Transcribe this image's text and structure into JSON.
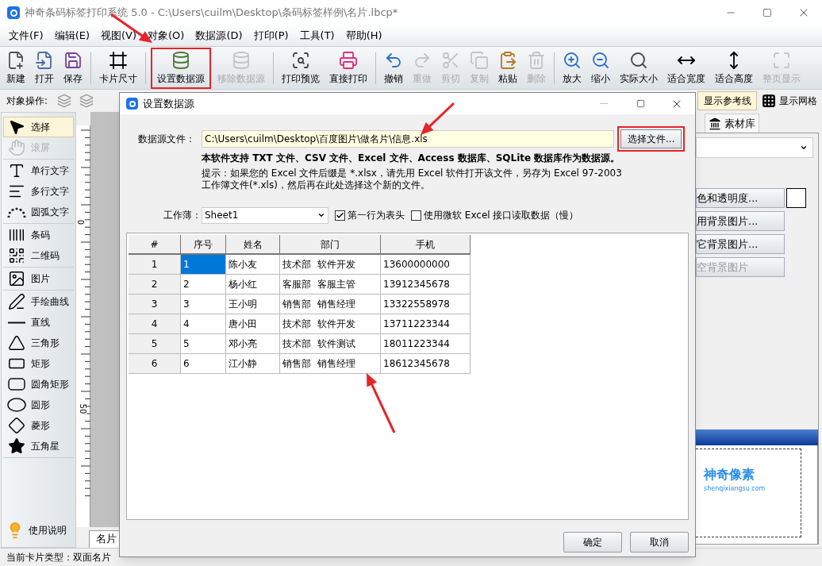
{
  "window": {
    "title": "神奇条码标签打印系统 5.0 - C:\\Users\\cuilm\\Desktop\\条码标签样例\\名片.lbcp*"
  },
  "menu": [
    "文件(F)",
    "编辑(E)",
    "视图(V)",
    "对象(O)",
    "数据源(D)",
    "打印(P)",
    "工具(T)",
    "帮助(H)"
  ],
  "toolbar": [
    {
      "label": "新建",
      "disabled": false
    },
    {
      "label": "打开",
      "disabled": false
    },
    {
      "label": "保存",
      "disabled": false
    },
    {
      "label": "卡片尺寸",
      "disabled": false
    },
    {
      "label": "设置数据源",
      "disabled": false
    },
    {
      "label": "移除数据源",
      "disabled": true
    },
    {
      "label": "打印预览",
      "disabled": false
    },
    {
      "label": "直接打印",
      "disabled": false
    },
    {
      "label": "撤销",
      "disabled": false
    },
    {
      "label": "重做",
      "disabled": true
    },
    {
      "label": "剪切",
      "disabled": true
    },
    {
      "label": "复制",
      "disabled": true
    },
    {
      "label": "粘贴",
      "disabled": false
    },
    {
      "label": "删除",
      "disabled": true
    },
    {
      "label": "放大",
      "disabled": false
    },
    {
      "label": "缩小",
      "disabled": false
    },
    {
      "label": "实际大小",
      "disabled": false
    },
    {
      "label": "适合宽度",
      "disabled": false
    },
    {
      "label": "适合高度",
      "disabled": false
    },
    {
      "label": "整页显示",
      "disabled": true
    }
  ],
  "object_bar": {
    "label": "对象操作:",
    "guides": "显示参考线",
    "grid": "显示网格"
  },
  "tools": [
    {
      "items": [
        {
          "label": "选择",
          "selected": true,
          "disabled": false
        },
        {
          "label": "滚屏",
          "selected": false,
          "disabled": true
        }
      ]
    },
    {
      "items": [
        {
          "label": "单行文字",
          "selected": false,
          "disabled": false
        },
        {
          "label": "多行文字",
          "selected": false,
          "disabled": false
        },
        {
          "label": "圆弧文字",
          "selected": false,
          "disabled": false
        }
      ]
    },
    {
      "items": [
        {
          "label": "条码",
          "selected": false,
          "disabled": false
        },
        {
          "label": "二维码",
          "selected": false,
          "disabled": false
        }
      ]
    },
    {
      "items": [
        {
          "label": "图片",
          "selected": false,
          "disabled": false
        }
      ]
    },
    {
      "items": [
        {
          "label": "手绘曲线",
          "selected": false,
          "disabled": false
        },
        {
          "label": "直线",
          "selected": false,
          "disabled": false
        },
        {
          "label": "三角形",
          "selected": false,
          "disabled": false
        },
        {
          "label": "矩形",
          "selected": false,
          "disabled": false
        },
        {
          "label": "圆角矩形",
          "selected": false,
          "disabled": false
        },
        {
          "label": "圆形",
          "selected": false,
          "disabled": false
        },
        {
          "label": "菱形",
          "selected": false,
          "disabled": false
        },
        {
          "label": "五角星",
          "selected": false,
          "disabled": false
        }
      ]
    }
  ],
  "help": "使用说明",
  "ruler": {
    "labels": [
      "0",
      "50"
    ]
  },
  "canvas_tab": "名片",
  "right_panel": {
    "tab": "素材库",
    "buttons": [
      {
        "label": "色和透明度...",
        "disabled": false
      },
      {
        "label": "用背景图片...",
        "disabled": false
      },
      {
        "label": "它背景图片...",
        "disabled": false
      },
      {
        "label": "空背景图片",
        "disabled": true
      }
    ],
    "preview": {
      "brand": "神奇像素",
      "site": "shenqixiangsu.com"
    }
  },
  "status_bar": "当前卡片类型：双面名片",
  "dialog": {
    "title": "设置数据源",
    "file_label": "数据源文件：",
    "file_value": "C:\\Users\\cuilm\\Desktop\\百度图片\\做名片\\信息.xls",
    "choose_button": "选择文件...",
    "support_note": "本软件支持 TXT 文件、CSV 文件、Excel 文件、Access 数据库、SQLite 数据库作为数据源。",
    "hint_lines": [
      "提示：如果您的 Excel 文件后缀是 *.xlsx，请先用 Excel 软件打开该文件，另存为 Excel 97-2003",
      "工作簿文件(*.xls)，然后再在此处选择这个新的文件。"
    ],
    "sheet_label": "工作薄：",
    "sheet_value": "Sheet1",
    "options": [
      {
        "label": "第一行为表头",
        "checked": true
      },
      {
        "label": "使用微软 Excel 接口读取数据（慢）",
        "checked": false
      }
    ],
    "table": {
      "columns": [
        "#",
        "序号",
        "姓名",
        "部门",
        "手机"
      ],
      "rows": [
        {
          "cells": [
            {
              "text": "1",
              "selected": false
            },
            {
              "text": "1",
              "selected": true
            },
            {
              "text": "陈小友",
              "selected": false
            },
            {
              "text": "技术部  软件开发",
              "selected": false
            },
            {
              "text": "13600000000",
              "selected": false
            }
          ]
        },
        {
          "cells": [
            {
              "text": "2",
              "selected": false
            },
            {
              "text": "2",
              "selected": false
            },
            {
              "text": "杨小红",
              "selected": false
            },
            {
              "text": "客服部  客服主管",
              "selected": false
            },
            {
              "text": "13912345678",
              "selected": false
            }
          ]
        },
        {
          "cells": [
            {
              "text": "3",
              "selected": false
            },
            {
              "text": "3",
              "selected": false
            },
            {
              "text": "王小明",
              "selected": false
            },
            {
              "text": "销售部  销售经理",
              "selected": false
            },
            {
              "text": "13322558978",
              "selected": false
            }
          ]
        },
        {
          "cells": [
            {
              "text": "4",
              "selected": false
            },
            {
              "text": "4",
              "selected": false
            },
            {
              "text": "唐小田",
              "selected": false
            },
            {
              "text": "技术部  软件开发",
              "selected": false
            },
            {
              "text": "13711223344",
              "selected": false
            }
          ]
        },
        {
          "cells": [
            {
              "text": "5",
              "selected": false
            },
            {
              "text": "5",
              "selected": false
            },
            {
              "text": "邓小亮",
              "selected": false
            },
            {
              "text": "技术部  软件测试",
              "selected": false
            },
            {
              "text": "18011223344",
              "selected": false
            }
          ]
        },
        {
          "cells": [
            {
              "text": "6",
              "selected": false
            },
            {
              "text": "6",
              "selected": false
            },
            {
              "text": "江小静",
              "selected": false
            },
            {
              "text": "销售部  销售经理",
              "selected": false
            },
            {
              "text": "18612345678",
              "selected": false
            }
          ]
        }
      ]
    },
    "buttons": [
      "确定",
      "取消"
    ]
  }
}
